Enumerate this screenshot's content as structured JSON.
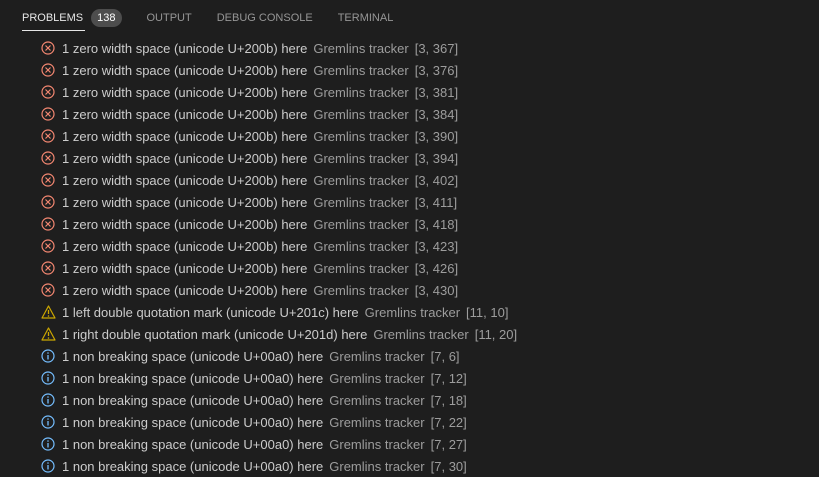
{
  "tabs": {
    "problems": "PROBLEMS",
    "problems_count": "138",
    "output": "OUTPUT",
    "debug_console": "DEBUG CONSOLE",
    "terminal": "TERMINAL"
  },
  "colors": {
    "error": "#f48771",
    "warning": "#cca700",
    "info": "#75beff"
  },
  "problems": [
    {
      "severity": "error",
      "message": "1 zero width space (unicode U+200b) here",
      "source": "Gremlins tracker",
      "position": "[3, 367]"
    },
    {
      "severity": "error",
      "message": "1 zero width space (unicode U+200b) here",
      "source": "Gremlins tracker",
      "position": "[3, 376]"
    },
    {
      "severity": "error",
      "message": "1 zero width space (unicode U+200b) here",
      "source": "Gremlins tracker",
      "position": "[3, 381]"
    },
    {
      "severity": "error",
      "message": "1 zero width space (unicode U+200b) here",
      "source": "Gremlins tracker",
      "position": "[3, 384]"
    },
    {
      "severity": "error",
      "message": "1 zero width space (unicode U+200b) here",
      "source": "Gremlins tracker",
      "position": "[3, 390]"
    },
    {
      "severity": "error",
      "message": "1 zero width space (unicode U+200b) here",
      "source": "Gremlins tracker",
      "position": "[3, 394]"
    },
    {
      "severity": "error",
      "message": "1 zero width space (unicode U+200b) here",
      "source": "Gremlins tracker",
      "position": "[3, 402]"
    },
    {
      "severity": "error",
      "message": "1 zero width space (unicode U+200b) here",
      "source": "Gremlins tracker",
      "position": "[3, 411]"
    },
    {
      "severity": "error",
      "message": "1 zero width space (unicode U+200b) here",
      "source": "Gremlins tracker",
      "position": "[3, 418]"
    },
    {
      "severity": "error",
      "message": "1 zero width space (unicode U+200b) here",
      "source": "Gremlins tracker",
      "position": "[3, 423]"
    },
    {
      "severity": "error",
      "message": "1 zero width space (unicode U+200b) here",
      "source": "Gremlins tracker",
      "position": "[3, 426]"
    },
    {
      "severity": "error",
      "message": "1 zero width space (unicode U+200b) here",
      "source": "Gremlins tracker",
      "position": "[3, 430]"
    },
    {
      "severity": "warning",
      "message": "1 left double quotation mark (unicode U+201c) here",
      "source": "Gremlins tracker",
      "position": "[11, 10]"
    },
    {
      "severity": "warning",
      "message": "1 right double quotation mark (unicode U+201d) here",
      "source": "Gremlins tracker",
      "position": "[11, 20]"
    },
    {
      "severity": "info",
      "message": "1 non breaking space (unicode U+00a0) here",
      "source": "Gremlins tracker",
      "position": "[7, 6]"
    },
    {
      "severity": "info",
      "message": "1 non breaking space (unicode U+00a0) here",
      "source": "Gremlins tracker",
      "position": "[7, 12]"
    },
    {
      "severity": "info",
      "message": "1 non breaking space (unicode U+00a0) here",
      "source": "Gremlins tracker",
      "position": "[7, 18]"
    },
    {
      "severity": "info",
      "message": "1 non breaking space (unicode U+00a0) here",
      "source": "Gremlins tracker",
      "position": "[7, 22]"
    },
    {
      "severity": "info",
      "message": "1 non breaking space (unicode U+00a0) here",
      "source": "Gremlins tracker",
      "position": "[7, 27]"
    },
    {
      "severity": "info",
      "message": "1 non breaking space (unicode U+00a0) here",
      "source": "Gremlins tracker",
      "position": "[7, 30]"
    }
  ]
}
